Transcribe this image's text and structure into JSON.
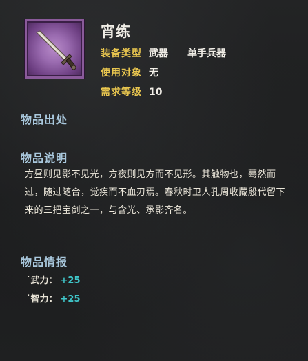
{
  "item": {
    "name": "宵练",
    "icon": "sword-icon",
    "rarity_color": "#9a6bb0",
    "attributes": [
      {
        "label": "装备类型",
        "value": "武器",
        "value2": "单手兵器"
      },
      {
        "label": "使用对象",
        "value": "无"
      },
      {
        "label": "需求等级",
        "value": "10"
      }
    ]
  },
  "sections": {
    "source": {
      "heading": "物品出处"
    },
    "description": {
      "heading": "物品说明",
      "text": "方昼则见影不见光，方夜则见方而不见形。其触物也，蓦然而过，随过随合，觉疾而不血刃焉。春秋时卫人孔周收藏殷代留下来的三把宝剑之一，与含光、承影齐名。"
    },
    "info": {
      "heading": "物品情报",
      "stats": [
        {
          "label": "˙武力：",
          "value": "+25"
        },
        {
          "label": "˙智力：",
          "value": "+25"
        }
      ]
    }
  },
  "colors": {
    "attribute_label": "#e9c64f",
    "section_heading": "#a9c8dd",
    "stat_value": "#3fc6c9"
  }
}
